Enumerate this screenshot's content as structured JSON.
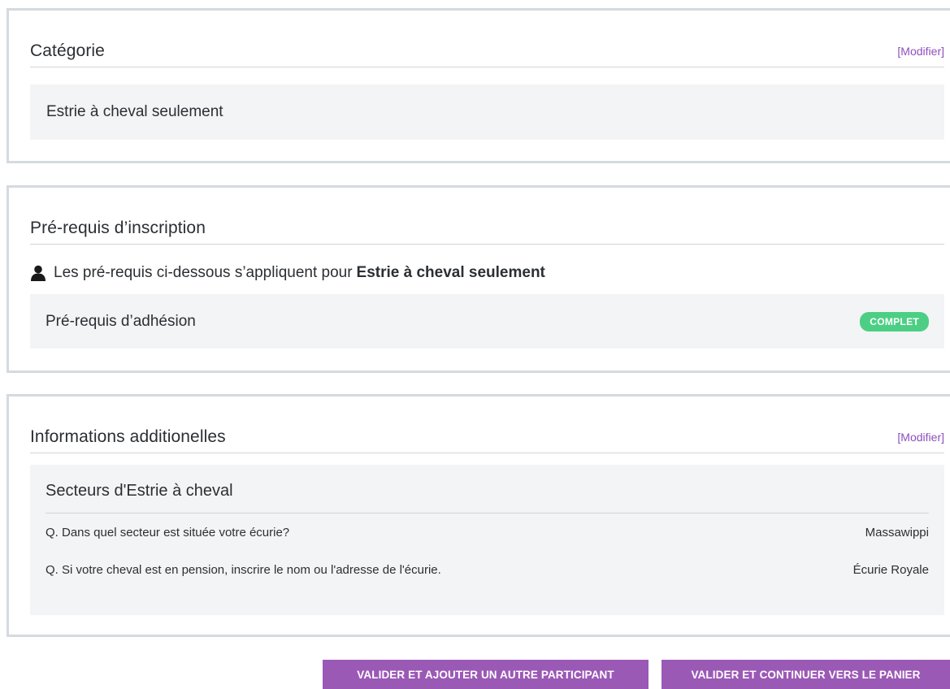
{
  "category_card": {
    "title": "Catégorie",
    "modify_label": "[Modifier]",
    "value": "Estrie à cheval seulement"
  },
  "prerequisites_card": {
    "title": "Pré-requis d’inscription",
    "applies_text": "Les pré-requis ci-dessous s’appliquent pour",
    "applies_target": "Estrie à cheval seulement",
    "items": [
      {
        "label": "Pré-requis d’adhésion",
        "status": "COMPLET",
        "status_color": "#4ccf84"
      }
    ],
    "icon": "user-icon"
  },
  "additional_info_card": {
    "title": "Informations additionelles",
    "modify_label": "[Modifier]",
    "section_title": "Secteurs d'Estrie à cheval",
    "questions": [
      {
        "question": "Q. Dans quel secteur est située votre écurie?",
        "answer": "Massawippi"
      },
      {
        "question": "Q. Si votre cheval est en pension, inscrire le nom ou l'adresse de l'écurie.",
        "answer": "Écurie Royale"
      }
    ]
  },
  "actions": {
    "add_participant_label": "VALIDER ET AJOUTER UN AUTRE PARTICIPANT",
    "continue_cart_label": "VALIDER ET CONTINUER VERS LE PANIER"
  },
  "colors": {
    "accent": "#9b59b6",
    "link": "#8e4fbd",
    "card_border": "#d5dadf",
    "panel_bg": "#f3f4f6"
  }
}
